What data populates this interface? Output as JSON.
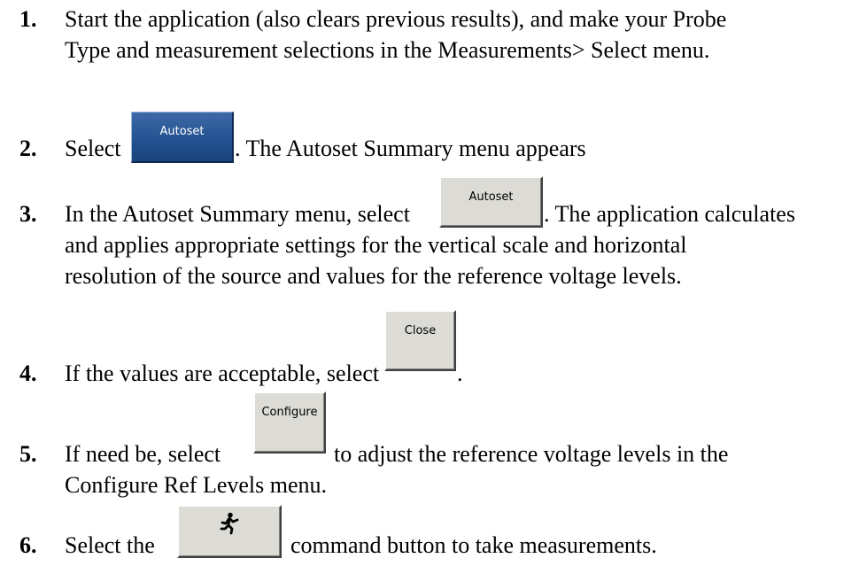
{
  "steps": [
    {
      "number": "1.",
      "lines": [
        "Start the application (also clears previous results), and make your Probe",
        "Type and measurement selections in the Measurements> Select menu."
      ]
    },
    {
      "number": "2.",
      "before": "Select",
      "button": "Autoset",
      "after": ". The Autoset Summary menu appears"
    },
    {
      "number": "3.",
      "before": "In the Autoset Summary menu, select",
      "button": "Autoset",
      "after": ". The application calculates",
      "lines": [
        "and applies appropriate settings for the vertical scale and horizontal",
        "resolution of the source and values for the reference voltage levels."
      ]
    },
    {
      "number": "4.",
      "before": "If the values are acceptable, select",
      "button": "Close",
      "after": "."
    },
    {
      "number": "5.",
      "before": "If need be, select",
      "button": "Configure",
      "after": "to adjust the reference voltage levels in the",
      "lines": [
        "Configure Ref Levels menu."
      ]
    },
    {
      "number": "6.",
      "before": "Select the",
      "button_icon": "running-man-icon",
      "after": "command button to take measurements."
    }
  ]
}
